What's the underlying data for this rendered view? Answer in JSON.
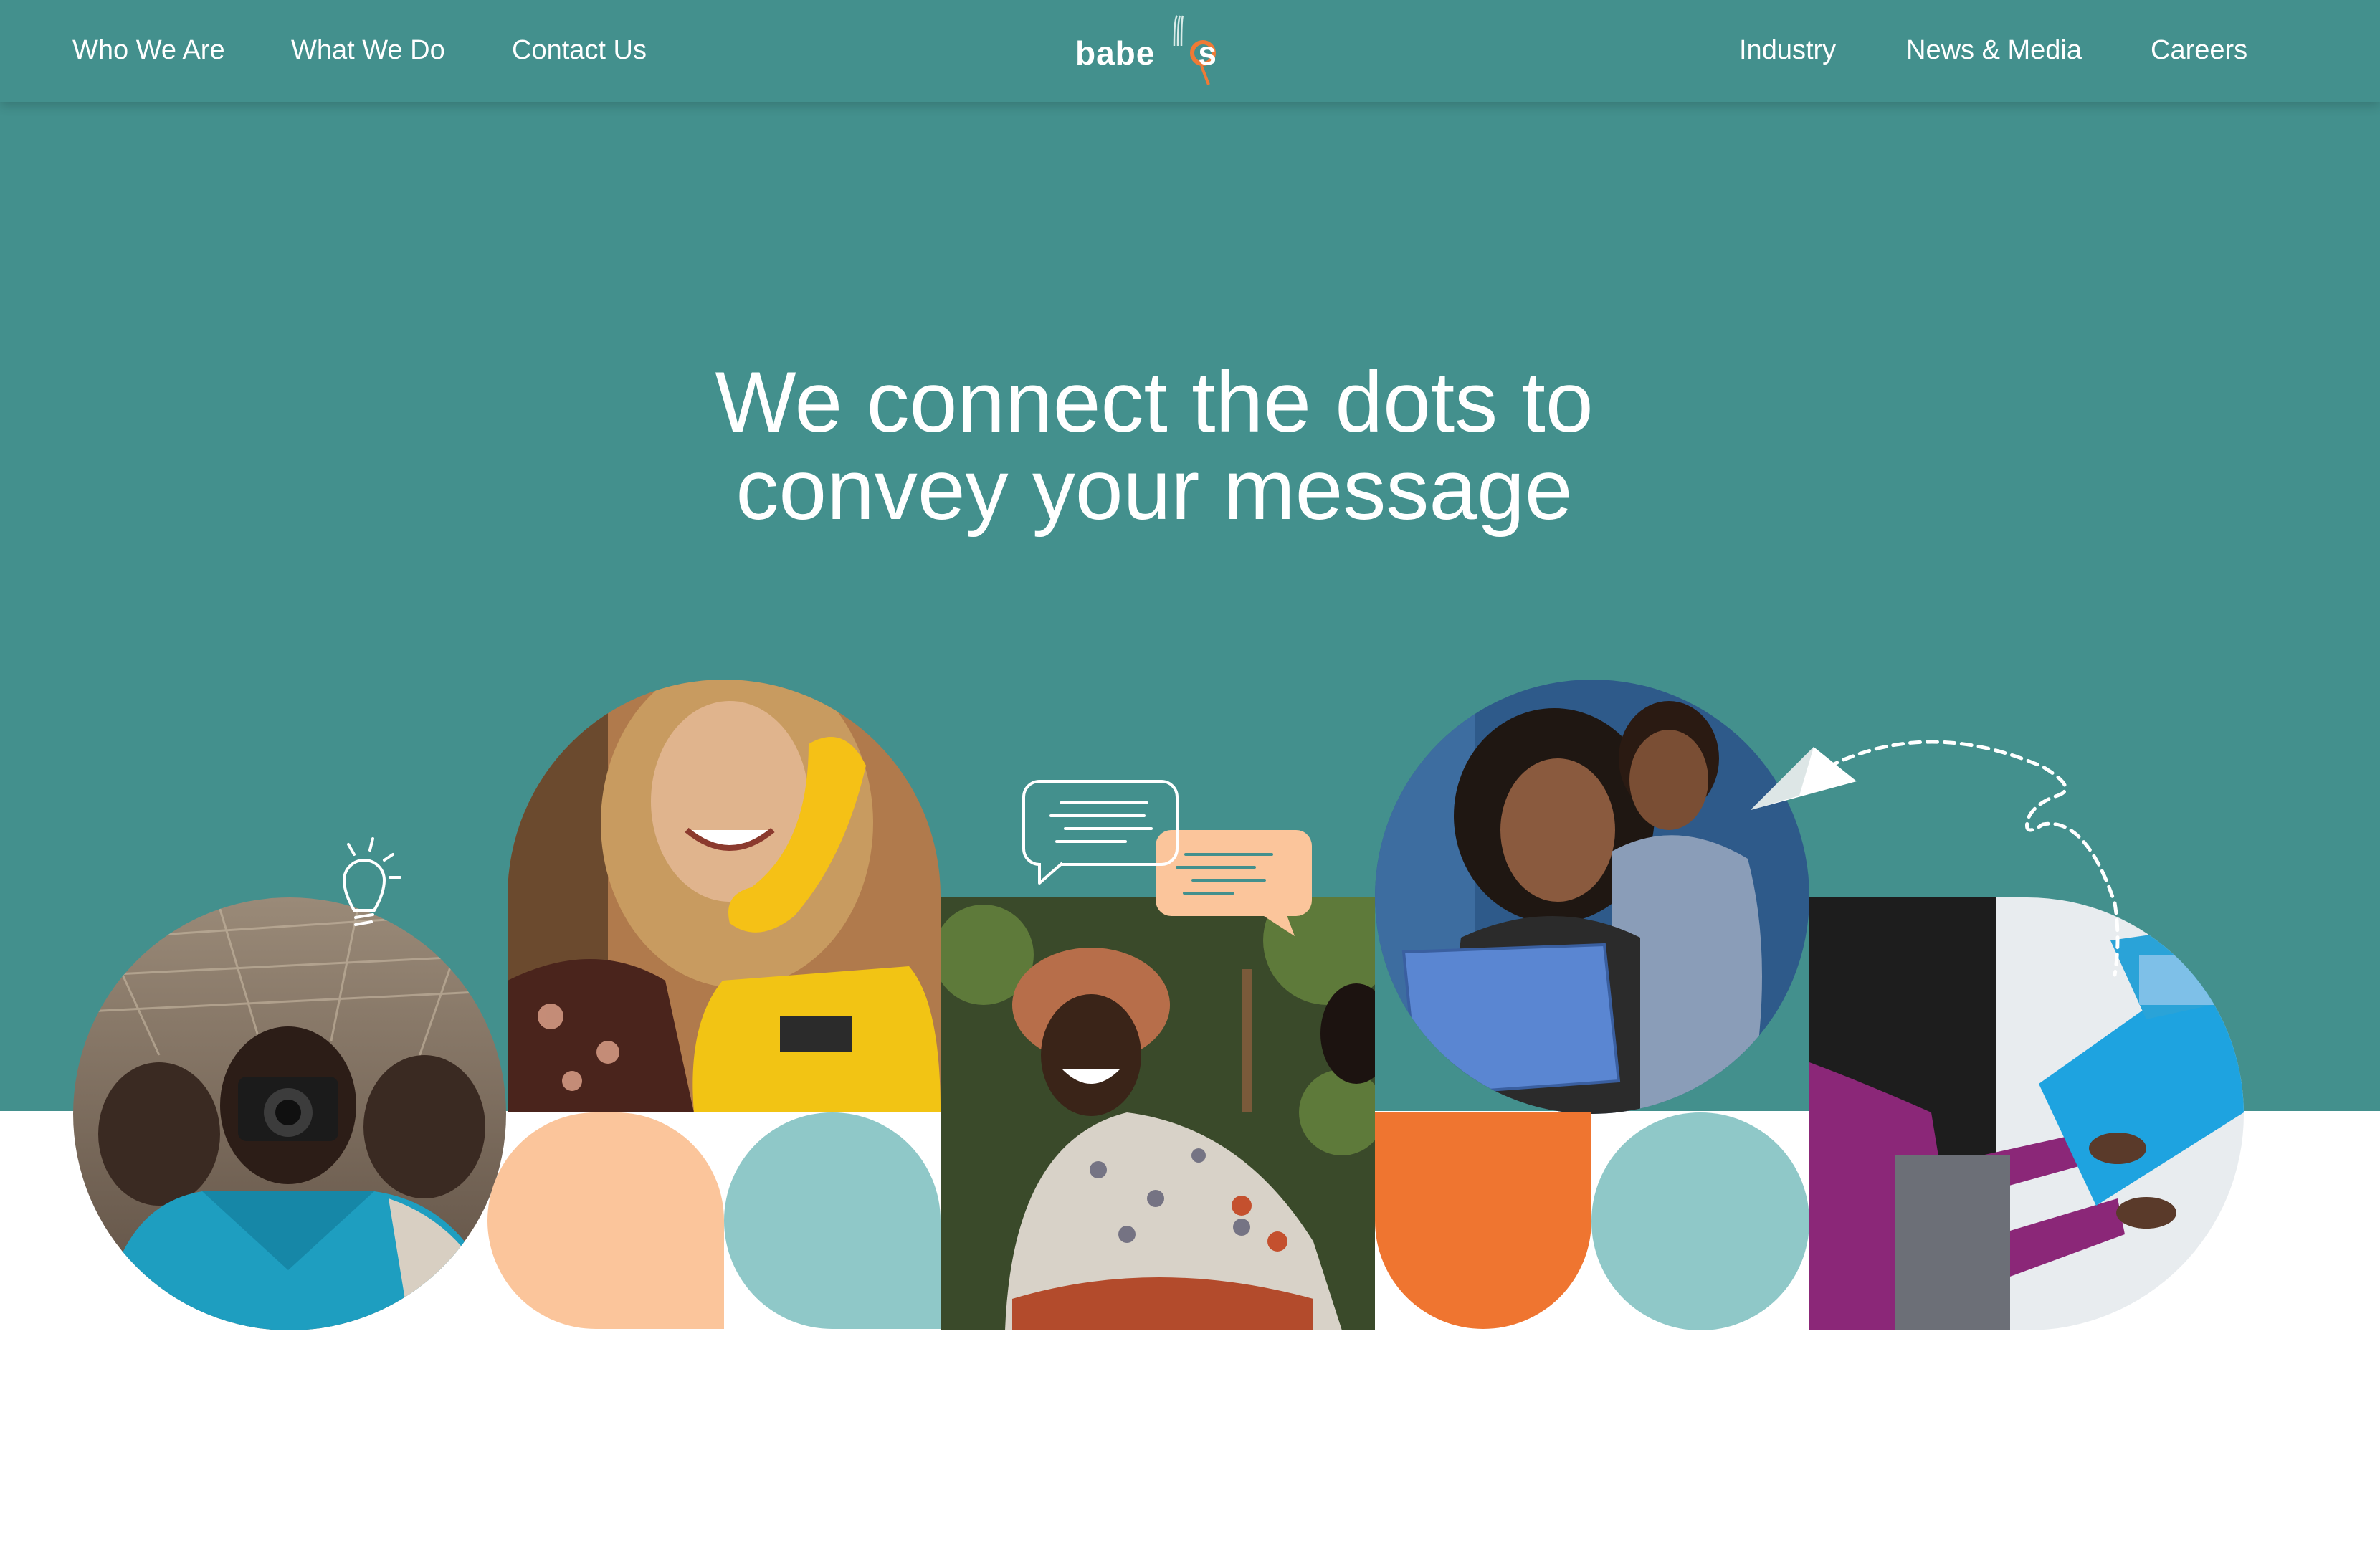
{
  "nav": {
    "left": [
      {
        "label": "Who We Are"
      },
      {
        "label": "What We Do"
      },
      {
        "label": "Contact Us"
      }
    ],
    "right": [
      {
        "label": "Industry"
      },
      {
        "label": "News & Media"
      },
      {
        "label": "Careers"
      }
    ],
    "logo": {
      "text_main": "babe",
      "text_accent_left": "l",
      "text_accent": "o",
      "text_end": "s"
    }
  },
  "hero": {
    "headline_line1": "We connect the dots to",
    "headline_line2": "convey your message"
  },
  "colors": {
    "teal": "#43908d",
    "peach": "#fbc59b",
    "light_teal": "#8fc8c8",
    "orange": "#ef7530",
    "white": "#ffffff"
  },
  "images": [
    {
      "name": "children-with-camera-photo"
    },
    {
      "name": "woman-on-yellow-phone-photo"
    },
    {
      "name": "woman-farming-photo"
    },
    {
      "name": "mother-and-son-laptop-photo"
    },
    {
      "name": "hands-typing-laptop-photo"
    }
  ],
  "icons": [
    "lightbulb-icon",
    "chat-bubbles-icon",
    "paper-plane-icon"
  ]
}
